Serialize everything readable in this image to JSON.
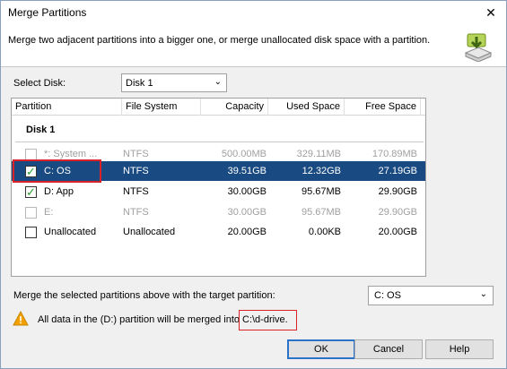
{
  "window": {
    "title": "Merge Partitions",
    "close_glyph": "✕"
  },
  "header": {
    "description": "Merge two adjacent partitions into a bigger one, or merge unallocated disk space with a partition.",
    "icon": "disk-merge-icon"
  },
  "select_disk": {
    "label": "Select Disk:",
    "value": "Disk 1"
  },
  "table": {
    "columns": [
      "Partition",
      "File System",
      "Capacity",
      "Used Space",
      "Free Space"
    ],
    "group": "Disk 1",
    "rows": [
      {
        "partition": "*: System ...",
        "fs": "NTFS",
        "capacity": "500.00MB",
        "used": "329.11MB",
        "free": "170.89MB",
        "checked": false,
        "disabled": true,
        "selected": false
      },
      {
        "partition": "C:  OS",
        "fs": "NTFS",
        "capacity": "39.51GB",
        "used": "12.32GB",
        "free": "27.19GB",
        "checked": true,
        "disabled": false,
        "selected": true
      },
      {
        "partition": "D:  App",
        "fs": "NTFS",
        "capacity": "30.00GB",
        "used": "95.67MB",
        "free": "29.90GB",
        "checked": true,
        "disabled": false,
        "selected": false
      },
      {
        "partition": "E:",
        "fs": "NTFS",
        "capacity": "30.00GB",
        "used": "95.67MB",
        "free": "29.90GB",
        "checked": false,
        "disabled": true,
        "selected": false
      },
      {
        "partition": "Unallocated",
        "fs": "Unallocated",
        "capacity": "20.00GB",
        "used": "0.00KB",
        "free": "20.00GB",
        "checked": false,
        "disabled": false,
        "selected": false
      }
    ]
  },
  "merge": {
    "label": "Merge the selected partitions above with the target partition:",
    "target": "C:  OS"
  },
  "warning": {
    "text": "All data in the (D:) partition will be merged into",
    "path": "C:\\d-drive."
  },
  "buttons": {
    "ok": "OK",
    "cancel": "Cancel",
    "help": "Help"
  },
  "colors": {
    "selection": "#1a4a82",
    "highlight_border": "#d8232a",
    "check": "#2a9d2a",
    "warning": "#f2a100"
  }
}
